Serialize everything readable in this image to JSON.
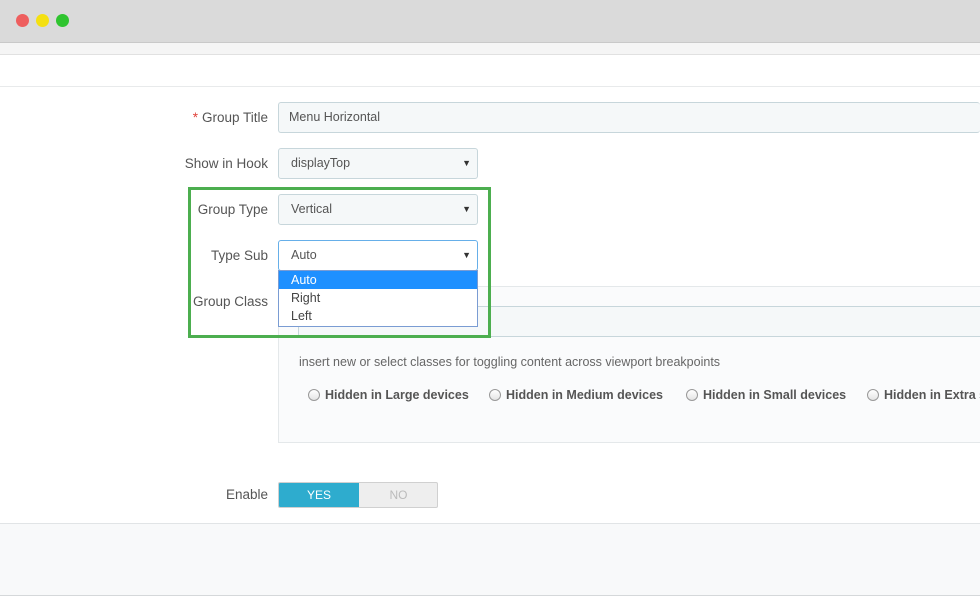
{
  "window": {
    "controls": [
      "close",
      "minimize",
      "maximize"
    ]
  },
  "form": {
    "group_title": {
      "required_mark": "*",
      "label": "Group Title",
      "value": "Menu Horizontal"
    },
    "show_in_hook": {
      "label": "Show in Hook",
      "value": "displayTop"
    },
    "group_type": {
      "label": "Group Type",
      "value": "Vertical"
    },
    "type_sub": {
      "label": "Type Sub",
      "value": "Auto",
      "options": [
        "Auto",
        "Right",
        "Left"
      ],
      "selected_index": 0
    },
    "group_class": {
      "label": "Group Class",
      "help": "insert new or select classes for toggling content across viewport breakpoints",
      "checkboxes": [
        {
          "label": "Hidden in Large devices"
        },
        {
          "label": "Hidden in Medium devices"
        },
        {
          "label": "Hidden in Small devices"
        },
        {
          "label": "Hidden in Extra s"
        }
      ]
    },
    "enable": {
      "label": "Enable",
      "yes": "YES",
      "no": "NO",
      "value": "YES"
    }
  },
  "colors": {
    "highlight": "#4cae4f",
    "toggle_active": "#2eacce",
    "dropdown_selected": "#1e90ff",
    "required": "#e0423a"
  },
  "icons": {
    "select_arrow": "▼"
  }
}
